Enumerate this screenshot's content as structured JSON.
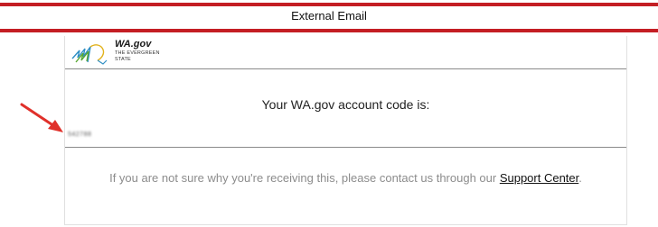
{
  "banner": {
    "text": "External Email",
    "color": "#c41e24"
  },
  "logo": {
    "name": "WA.gov",
    "tagline_line1": "THE EVERGREEN",
    "tagline_line2": "STATE"
  },
  "email": {
    "heading": "Your WA.gov account code is:",
    "code": "542788",
    "footer_text": "If you are not sure why you're receiving this, please contact us through our ",
    "link_label": "Support Center",
    "footer_end": "."
  },
  "annotation": {
    "arrow_icon": "red-arrow-icon",
    "arrow_color": "#e0302a"
  }
}
